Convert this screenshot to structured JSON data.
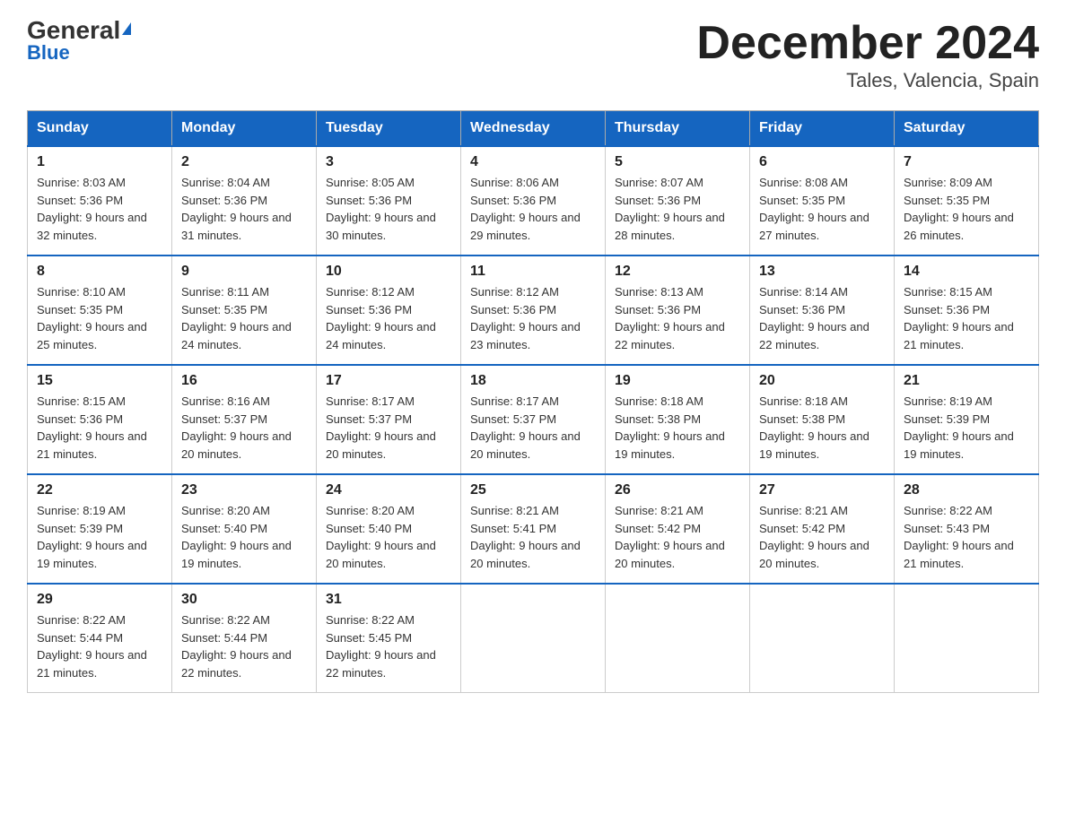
{
  "logo": {
    "general": "General",
    "blue": "Blue",
    "triangle": "▶"
  },
  "title": "December 2024",
  "subtitle": "Tales, Valencia, Spain",
  "days_of_week": [
    "Sunday",
    "Monday",
    "Tuesday",
    "Wednesday",
    "Thursday",
    "Friday",
    "Saturday"
  ],
  "weeks": [
    [
      {
        "day": "1",
        "sunrise": "8:03 AM",
        "sunset": "5:36 PM",
        "daylight": "9 hours and 32 minutes."
      },
      {
        "day": "2",
        "sunrise": "8:04 AM",
        "sunset": "5:36 PM",
        "daylight": "9 hours and 31 minutes."
      },
      {
        "day": "3",
        "sunrise": "8:05 AM",
        "sunset": "5:36 PM",
        "daylight": "9 hours and 30 minutes."
      },
      {
        "day": "4",
        "sunrise": "8:06 AM",
        "sunset": "5:36 PM",
        "daylight": "9 hours and 29 minutes."
      },
      {
        "day": "5",
        "sunrise": "8:07 AM",
        "sunset": "5:36 PM",
        "daylight": "9 hours and 28 minutes."
      },
      {
        "day": "6",
        "sunrise": "8:08 AM",
        "sunset": "5:35 PM",
        "daylight": "9 hours and 27 minutes."
      },
      {
        "day": "7",
        "sunrise": "8:09 AM",
        "sunset": "5:35 PM",
        "daylight": "9 hours and 26 minutes."
      }
    ],
    [
      {
        "day": "8",
        "sunrise": "8:10 AM",
        "sunset": "5:35 PM",
        "daylight": "9 hours and 25 minutes."
      },
      {
        "day": "9",
        "sunrise": "8:11 AM",
        "sunset": "5:35 PM",
        "daylight": "9 hours and 24 minutes."
      },
      {
        "day": "10",
        "sunrise": "8:12 AM",
        "sunset": "5:36 PM",
        "daylight": "9 hours and 24 minutes."
      },
      {
        "day": "11",
        "sunrise": "8:12 AM",
        "sunset": "5:36 PM",
        "daylight": "9 hours and 23 minutes."
      },
      {
        "day": "12",
        "sunrise": "8:13 AM",
        "sunset": "5:36 PM",
        "daylight": "9 hours and 22 minutes."
      },
      {
        "day": "13",
        "sunrise": "8:14 AM",
        "sunset": "5:36 PM",
        "daylight": "9 hours and 22 minutes."
      },
      {
        "day": "14",
        "sunrise": "8:15 AM",
        "sunset": "5:36 PM",
        "daylight": "9 hours and 21 minutes."
      }
    ],
    [
      {
        "day": "15",
        "sunrise": "8:15 AM",
        "sunset": "5:36 PM",
        "daylight": "9 hours and 21 minutes."
      },
      {
        "day": "16",
        "sunrise": "8:16 AM",
        "sunset": "5:37 PM",
        "daylight": "9 hours and 20 minutes."
      },
      {
        "day": "17",
        "sunrise": "8:17 AM",
        "sunset": "5:37 PM",
        "daylight": "9 hours and 20 minutes."
      },
      {
        "day": "18",
        "sunrise": "8:17 AM",
        "sunset": "5:37 PM",
        "daylight": "9 hours and 20 minutes."
      },
      {
        "day": "19",
        "sunrise": "8:18 AM",
        "sunset": "5:38 PM",
        "daylight": "9 hours and 19 minutes."
      },
      {
        "day": "20",
        "sunrise": "8:18 AM",
        "sunset": "5:38 PM",
        "daylight": "9 hours and 19 minutes."
      },
      {
        "day": "21",
        "sunrise": "8:19 AM",
        "sunset": "5:39 PM",
        "daylight": "9 hours and 19 minutes."
      }
    ],
    [
      {
        "day": "22",
        "sunrise": "8:19 AM",
        "sunset": "5:39 PM",
        "daylight": "9 hours and 19 minutes."
      },
      {
        "day": "23",
        "sunrise": "8:20 AM",
        "sunset": "5:40 PM",
        "daylight": "9 hours and 19 minutes."
      },
      {
        "day": "24",
        "sunrise": "8:20 AM",
        "sunset": "5:40 PM",
        "daylight": "9 hours and 20 minutes."
      },
      {
        "day": "25",
        "sunrise": "8:21 AM",
        "sunset": "5:41 PM",
        "daylight": "9 hours and 20 minutes."
      },
      {
        "day": "26",
        "sunrise": "8:21 AM",
        "sunset": "5:42 PM",
        "daylight": "9 hours and 20 minutes."
      },
      {
        "day": "27",
        "sunrise": "8:21 AM",
        "sunset": "5:42 PM",
        "daylight": "9 hours and 20 minutes."
      },
      {
        "day": "28",
        "sunrise": "8:22 AM",
        "sunset": "5:43 PM",
        "daylight": "9 hours and 21 minutes."
      }
    ],
    [
      {
        "day": "29",
        "sunrise": "8:22 AM",
        "sunset": "5:44 PM",
        "daylight": "9 hours and 21 minutes."
      },
      {
        "day": "30",
        "sunrise": "8:22 AM",
        "sunset": "5:44 PM",
        "daylight": "9 hours and 22 minutes."
      },
      {
        "day": "31",
        "sunrise": "8:22 AM",
        "sunset": "5:45 PM",
        "daylight": "9 hours and 22 minutes."
      },
      null,
      null,
      null,
      null
    ]
  ],
  "labels": {
    "sunrise": "Sunrise:",
    "sunset": "Sunset:",
    "daylight": "Daylight:"
  }
}
